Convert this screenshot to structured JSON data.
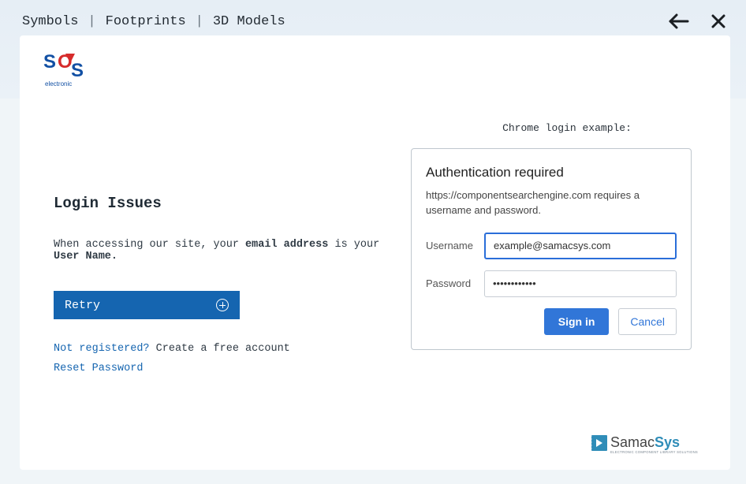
{
  "header": {
    "tabs": [
      "Symbols",
      "Footprints",
      "3D Models"
    ],
    "separator": "|"
  },
  "logo": {
    "text_top": "SOS",
    "text_bottom": "electronic"
  },
  "left": {
    "title": "Login Issues",
    "text_prefix": "When accessing our site, your ",
    "text_bold1": "email address",
    "text_mid": " is your ",
    "text_bold2": "User Name.",
    "retry_label": "Retry",
    "not_registered": "Not registered?",
    "create_account": "Create a free account",
    "reset_password": "Reset Password"
  },
  "right": {
    "caption": "Chrome login example:",
    "auth_title": "Authentication required",
    "auth_msg": "https://componentsearchengine.com requires a username and password.",
    "username_label": "Username",
    "username_value": "example@samacsys.com",
    "password_label": "Password",
    "password_value": "••••••••••••",
    "signin_label": "Sign in",
    "cancel_label": "Cancel"
  },
  "footer": {
    "brand": "SamacSys"
  }
}
